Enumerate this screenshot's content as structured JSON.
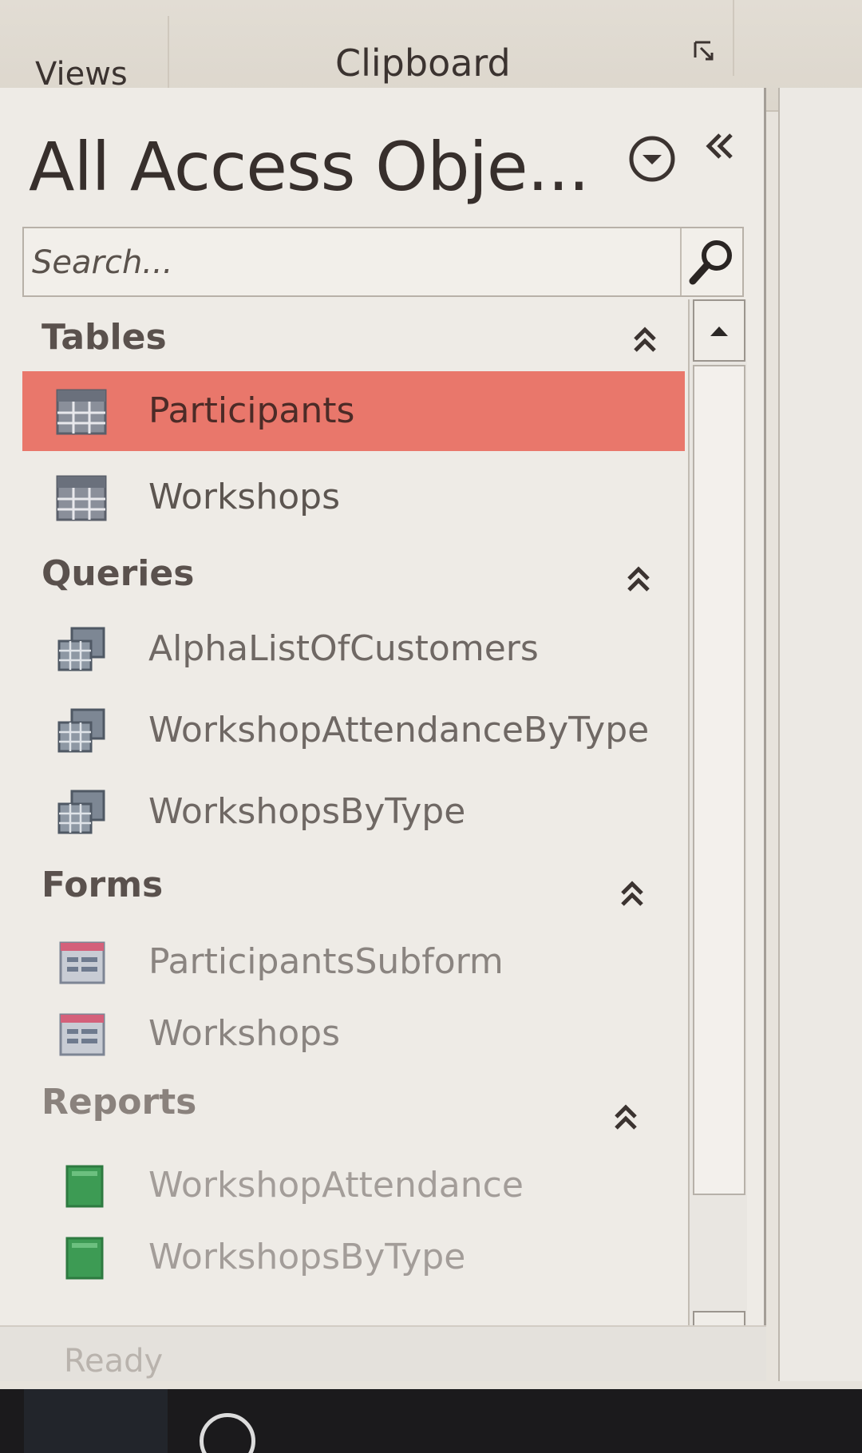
{
  "ribbon": {
    "groups": [
      "Views",
      "Clipboard"
    ],
    "launcher_icon": "dialog-launcher-icon"
  },
  "nav_pane": {
    "title": "All Access Obje...",
    "search_placeholder": "Search...",
    "categories": [
      {
        "name": "Tables",
        "items": [
          {
            "label": "Participants",
            "icon": "table-icon",
            "selected": true
          },
          {
            "label": "Workshops",
            "icon": "table-icon"
          }
        ]
      },
      {
        "name": "Queries",
        "items": [
          {
            "label": "AlphaListOfCustomers",
            "icon": "query-icon"
          },
          {
            "label": "WorkshopAttendanceByType",
            "icon": "query-icon"
          },
          {
            "label": "WorkshopsByType",
            "icon": "query-icon"
          }
        ]
      },
      {
        "name": "Forms",
        "items": [
          {
            "label": "ParticipantsSubform",
            "icon": "form-icon"
          },
          {
            "label": "Workshops",
            "icon": "form-icon"
          }
        ]
      },
      {
        "name": "Reports",
        "items": [
          {
            "label": "WorkshopAttendance",
            "icon": "report-icon"
          },
          {
            "label": "WorkshopsByType",
            "icon": "report-icon"
          }
        ]
      }
    ]
  },
  "status": {
    "text": "Ready"
  },
  "colors": {
    "selection": "#e9776b",
    "pane_bg": "#eeebe6",
    "report_green": "#3d9b54"
  }
}
